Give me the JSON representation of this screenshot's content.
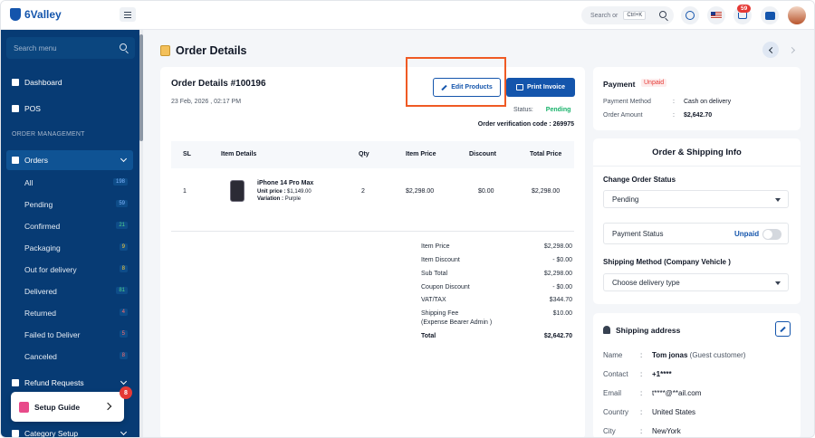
{
  "app": {
    "brand": "6Valley",
    "header": {
      "search_placeholder": "Search or",
      "search_shortcut": "Ctrl+K",
      "cart_count": "59"
    }
  },
  "sidebar": {
    "search_placeholder": "Search menu",
    "items": [
      {
        "label": "Dashboard",
        "icon": "home-icon"
      },
      {
        "label": "POS",
        "icon": "pos-icon"
      }
    ],
    "section_title": "ORDER MANAGEMENT",
    "orders_label": "Orders",
    "order_subitems": [
      {
        "label": "All",
        "count": "198",
        "color": "blue"
      },
      {
        "label": "Pending",
        "count": "59",
        "color": "blue"
      },
      {
        "label": "Confirmed",
        "count": "21",
        "color": "green"
      },
      {
        "label": "Packaging",
        "count": "9",
        "color": "yellow"
      },
      {
        "label": "Out for delivery",
        "count": "8",
        "color": "yellow"
      },
      {
        "label": "Delivered",
        "count": "81",
        "color": "green"
      },
      {
        "label": "Returned",
        "count": "4",
        "color": "red"
      },
      {
        "label": "Failed to Deliver",
        "count": "5",
        "color": "red"
      },
      {
        "label": "Canceled",
        "count": "8",
        "color": "red"
      }
    ],
    "refund_label": "Refund Requests",
    "category_label": "Category Setup",
    "setup_guide": {
      "label": "Setup Guide",
      "badge": "8"
    }
  },
  "page": {
    "title": "Order Details"
  },
  "order": {
    "title": "Order Details #100196",
    "date": "23 Feb, 2026 , 02:17 PM",
    "edit_button": "Edit Products",
    "print_button": "Print Invoice",
    "status_label": "Status:",
    "status_value": "Pending",
    "verification": "Order verification code : 269975",
    "table": {
      "headers": [
        "SL",
        "Item Details",
        "Qty",
        "Item Price",
        "Discount",
        "Total Price"
      ],
      "rows": [
        {
          "sl": "1",
          "name": "iPhone 14 Pro Max",
          "unit_price_label": "Unit price :",
          "unit_price": "$1,149.00",
          "variation_label": "Variation :",
          "variation": "Purple",
          "qty": "2",
          "item_price": "$2,298.00",
          "discount": "$0.00",
          "total": "$2,298.00"
        }
      ]
    },
    "summary": [
      {
        "label": "Item Price",
        "value": "$2,298.00"
      },
      {
        "label": "Item Discount",
        "value": "- $0.00"
      },
      {
        "label": "Sub Total",
        "value": "$2,298.00"
      },
      {
        "label": "Coupon Discount",
        "value": "- $0.00"
      },
      {
        "label": "VAT/TAX",
        "value": "$344.70"
      },
      {
        "label": "Shipping Fee",
        "label2": "(Expense Bearer Admin )",
        "value": "$10.00"
      },
      {
        "label": "Total",
        "value": "$2,642.70"
      }
    ]
  },
  "payment": {
    "title": "Payment",
    "badge": "Unpaid",
    "method_label": "Payment Method",
    "method_value": "Cash on delivery",
    "amount_label": "Order Amount",
    "amount_value": "$2,642.70"
  },
  "shipping_info": {
    "title": "Order & Shipping Info",
    "change_status_label": "Change Order Status",
    "status_selected": "Pending",
    "payment_status_label": "Payment Status",
    "payment_status_value": "Unpaid",
    "payment_status_on": false,
    "method_label": "Shipping Method (Company Vehicle )",
    "delivery_placeholder": "Choose delivery type"
  },
  "address": {
    "title": "Shipping address",
    "rows": [
      {
        "label": "Name",
        "value": "Tom jonas",
        "note": "(Guest customer)"
      },
      {
        "label": "Contact",
        "value": "+1****"
      },
      {
        "label": "Email",
        "value": "t****@**ail.com"
      },
      {
        "label": "Country",
        "value": "United States"
      },
      {
        "label": "City",
        "value": "NewYork"
      }
    ]
  },
  "colors": {
    "primary": "#1455ac",
    "sidebar_bg": "#073b74",
    "success": "#17b26a",
    "danger": "#e53935",
    "highlight_outline": "#ef5a24"
  }
}
